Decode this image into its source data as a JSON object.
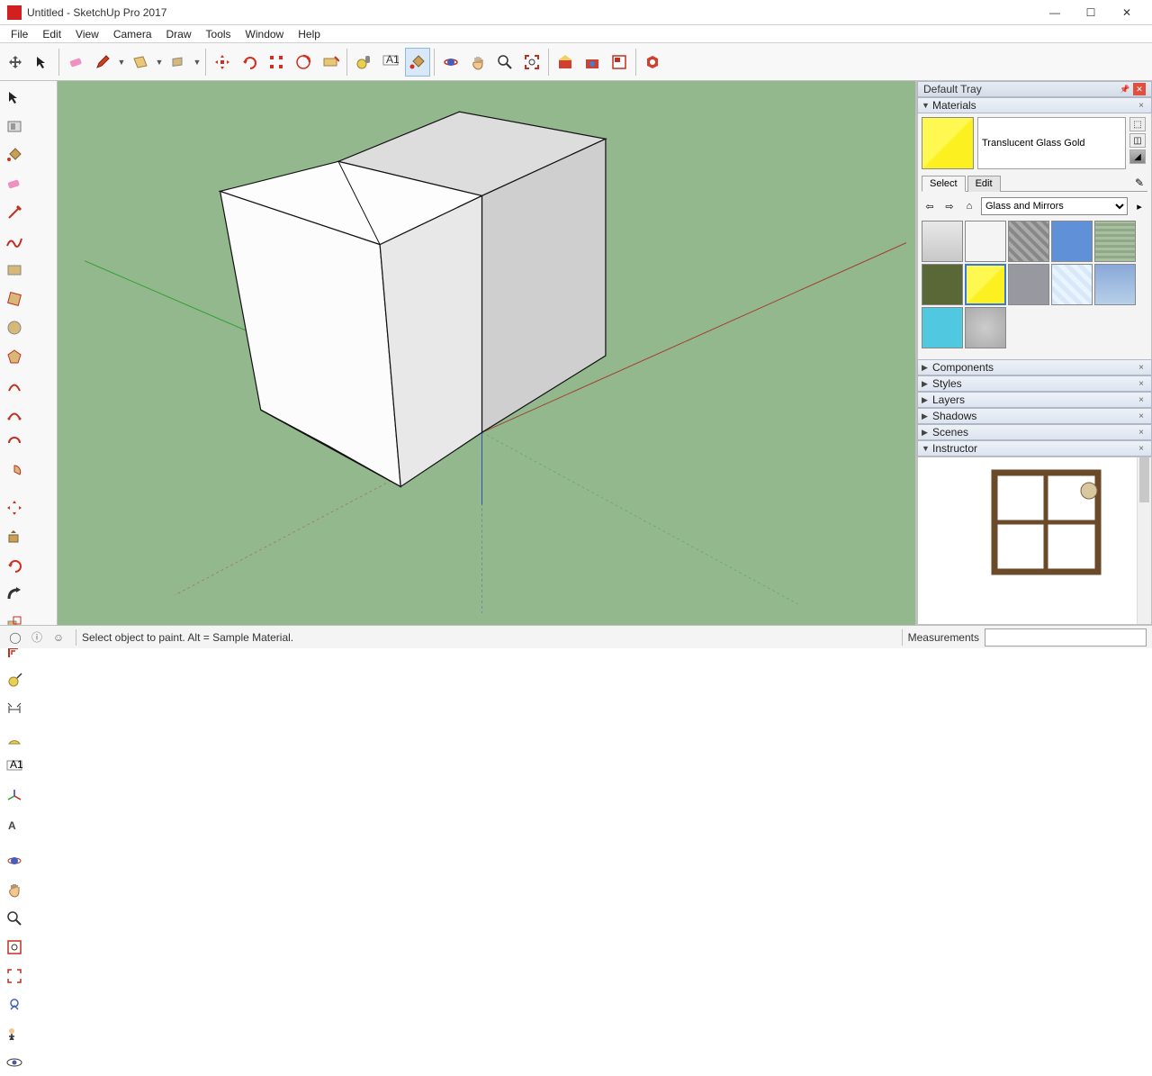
{
  "window": {
    "title": "Untitled - SketchUp Pro 2017"
  },
  "menu": [
    "File",
    "Edit",
    "View",
    "Camera",
    "Draw",
    "Tools",
    "Window",
    "Help"
  ],
  "tray": {
    "header": "Default Tray",
    "materials": {
      "title": "Materials",
      "current_name": "Translucent Glass Gold",
      "tabs": {
        "select": "Select",
        "edit": "Edit"
      },
      "library": "Glass and Mirrors",
      "swatches": [
        {
          "c": "linear-gradient(#e8e8e8,#c8c8c8)"
        },
        {
          "c": "#f4f4f4"
        },
        {
          "c": "repeating-linear-gradient(45deg,#888 0 4px,#aaa 4px 8px)"
        },
        {
          "c": "#6090d8"
        },
        {
          "c": "repeating-linear-gradient(0deg,#a8c0a0 0 3px,#90a888 3px 6px)"
        },
        {
          "c": "#5a6838"
        },
        {
          "c": "linear-gradient(135deg,#fff850 0%,#fff850 48%,#fcf020 52%,#fcf020 100%)",
          "sel": true
        },
        {
          "c": "#9898a0"
        },
        {
          "c": "repeating-linear-gradient(45deg,#d8e8f8 0 5px,#e8f4ff 5px 10px)"
        },
        {
          "c": "linear-gradient(#88a8d8,#b8d0e8)"
        },
        {
          "c": "#50c8e0"
        },
        {
          "c": "radial-gradient(#ccc,#aaa)"
        }
      ]
    },
    "panels": [
      "Components",
      "Styles",
      "Layers",
      "Shadows",
      "Scenes",
      "Instructor"
    ]
  },
  "status": {
    "hint": "Select object to paint. Alt = Sample Material.",
    "measurements_label": "Measurements"
  }
}
